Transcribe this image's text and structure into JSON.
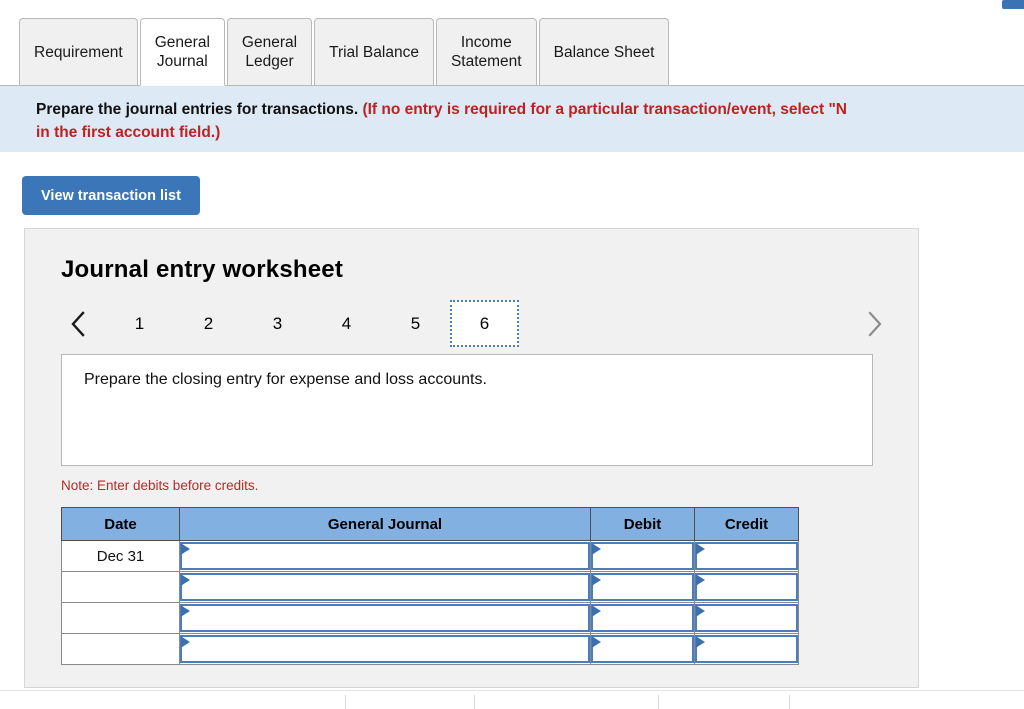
{
  "tabs": [
    {
      "label": "Requirement",
      "active": false
    },
    {
      "label": "General\nJournal",
      "active": true
    },
    {
      "label": "General\nLedger",
      "active": false
    },
    {
      "label": "Trial Balance",
      "active": false
    },
    {
      "label": "Income\nStatement",
      "active": false
    },
    {
      "label": "Balance Sheet",
      "active": false
    }
  ],
  "instruction": {
    "lead": "Prepare the journal entries for transactions.",
    "paren_line1": "(If no entry is required for a particular transaction/event, select \"N",
    "paren_line2": "in the first account field.)"
  },
  "toolbar": {
    "view_transaction_list_label": "View transaction list"
  },
  "worksheet": {
    "title": "Journal entry worksheet",
    "pager": {
      "prev_icon": "chevron-left-icon",
      "next_icon": "chevron-right-icon",
      "pages": [
        "1",
        "2",
        "3",
        "4",
        "5",
        "6"
      ],
      "active_page": "6"
    },
    "prompt": "Prepare the closing entry for expense and loss accounts.",
    "note": "Note: Enter debits before credits.",
    "table": {
      "headers": [
        "Date",
        "General Journal",
        "Debit",
        "Credit"
      ],
      "rows": [
        {
          "date": "Dec 31",
          "general_journal": "",
          "debit": "",
          "credit": ""
        },
        {
          "date": "",
          "general_journal": "",
          "debit": "",
          "credit": ""
        },
        {
          "date": "",
          "general_journal": "",
          "debit": "",
          "credit": ""
        },
        {
          "date": "",
          "general_journal": "",
          "debit": "",
          "credit": ""
        }
      ]
    }
  },
  "colors": {
    "accent_blue": "#3a76b8",
    "table_header_blue": "#82b0e0",
    "field_border_blue": "#4a7ebb",
    "banner_blue": "#ddeaf6",
    "alert_red": "#c0201f",
    "note_red": "#b52b27",
    "panel_gray": "#f1f1f1"
  }
}
